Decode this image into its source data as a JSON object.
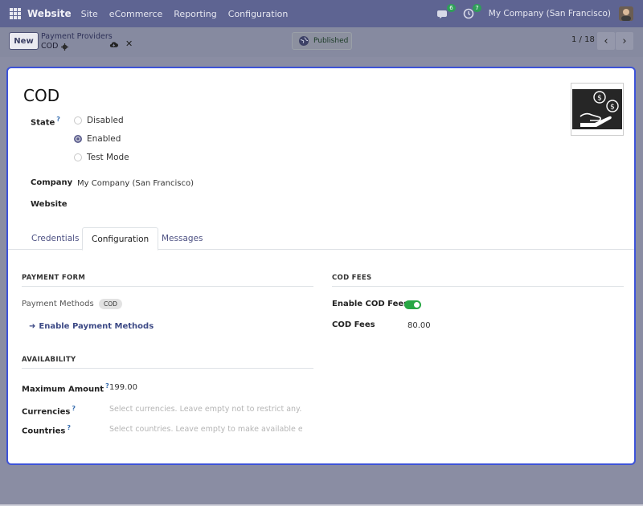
{
  "navbar": {
    "brand": "Website",
    "menu": [
      "Site",
      "eCommerce",
      "Reporting",
      "Configuration"
    ],
    "messages_badge": "6",
    "activity_badge": "7",
    "company": "My Company (San Francisco)"
  },
  "control_panel": {
    "new_label": "New",
    "breadcrumb_parent": "Payment Providers",
    "breadcrumb_current": "COD",
    "published_label": "Published",
    "pager": "1 / 18"
  },
  "form": {
    "title": "COD",
    "state_label": "State",
    "help_mark": "?",
    "state_options": [
      {
        "label": "Disabled",
        "checked": false
      },
      {
        "label": "Enabled",
        "checked": true
      },
      {
        "label": "Test Mode",
        "checked": false
      }
    ],
    "company_label": "Company",
    "company_value": "My Company (San Francisco)",
    "website_label": "Website",
    "tabs": [
      "Credentials",
      "Configuration",
      "Messages"
    ],
    "active_tab": "Configuration",
    "payment_form": {
      "title": "PAYMENT FORM",
      "methods_label": "Payment Methods",
      "methods_tag": "COD",
      "enable_link": "Enable Payment Methods"
    },
    "cod_fees": {
      "title": "COD FEES",
      "enable_label": "Enable COD Fees",
      "enabled": true,
      "fees_label": "COD Fees",
      "fees_value": "80.00"
    },
    "availability": {
      "title": "AVAILABILITY",
      "max_amount_label": "Maximum Amount",
      "max_amount_value": "199.00",
      "currencies_label": "Currencies",
      "currencies_placeholder": "Select currencies. Leave empty not to restrict any.",
      "countries_label": "Countries",
      "countries_placeholder": "Select countries. Leave empty to make available ev..."
    }
  },
  "colors": {
    "navbar": "#5e6492",
    "sheet_border": "#3d53d8",
    "toggle_on": "#28a745",
    "badge": "#2f9e59"
  }
}
